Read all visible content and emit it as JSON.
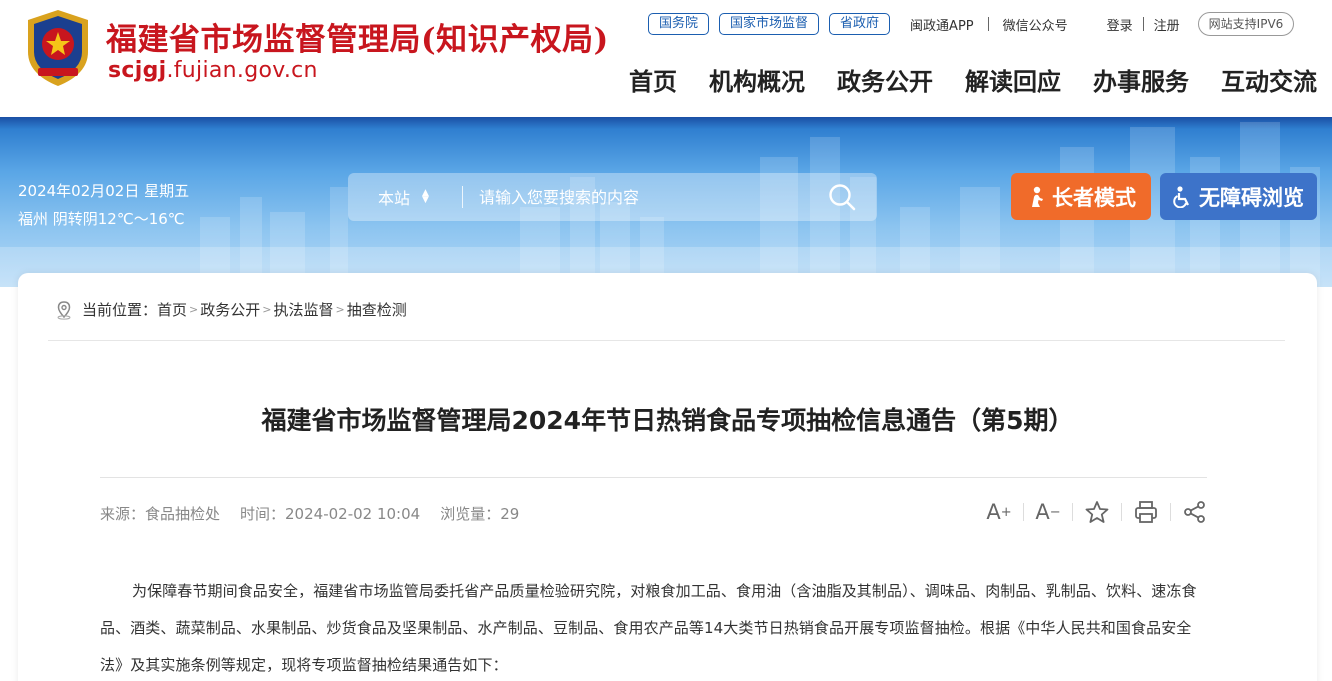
{
  "header": {
    "site_name": "福建省市场监督管理局(知识产权局)",
    "domain_bold": "scjgj",
    "domain_rest": ".fujian.gov.cn",
    "top_links": {
      "gov_council": "国务院",
      "samr": "国家市场监督",
      "province": "省政府",
      "app": "闽政通APP",
      "wechat": "微信公众号",
      "login": "登录",
      "register": "注册",
      "ipv6": "网站支持IPV6"
    },
    "nav": [
      "首页",
      "机构概况",
      "政务公开",
      "解读回应",
      "办事服务",
      "互动交流"
    ]
  },
  "banner": {
    "date": "2024年02月02日 星期五",
    "weather": "福州 阴转阴12℃～16℃",
    "search_scope": "本站",
    "search_placeholder": "请输入您要搜索的内容",
    "elder_mode": "长者模式",
    "accessible": "无障碍浏览"
  },
  "breadcrumb": {
    "prefix": "当前位置：",
    "items": [
      "首页",
      "政务公开",
      "执法监督",
      "抽查检测"
    ]
  },
  "article": {
    "title": "福建省市场监督管理局2024年节日热销食品专项抽检信息通告（第5期）",
    "source": "来源：食品抽检处",
    "time": "时间：2024-02-02 10:04",
    "views": "浏览量：29",
    "body": "为保障春节期间食品安全，福建省市场监管局委托省产品质量检验研究院，对粮食加工品、食用油（含油脂及其制品）、调味品、肉制品、乳制品、饮料、速冻食品、酒类、蔬菜制品、水果制品、炒货食品及坚果制品、水产制品、豆制品、食用农产品等14大类节日热销食品开展专项监督抽检。根据《中华人民共和国食品安全法》及其实施条例等规定，现将专项监督抽检结果通告如下："
  },
  "colors": {
    "brand_red": "#c8161e",
    "link_blue": "#1b5eb0",
    "elder_orange": "#f06b2a",
    "access_blue": "#3d73c9"
  },
  "icons": [
    "emblem-icon",
    "search-icon",
    "elder-icon",
    "wheelchair-icon",
    "location-icon",
    "font-increase-icon",
    "font-decrease-icon",
    "star-icon",
    "print-icon",
    "share-icon"
  ]
}
